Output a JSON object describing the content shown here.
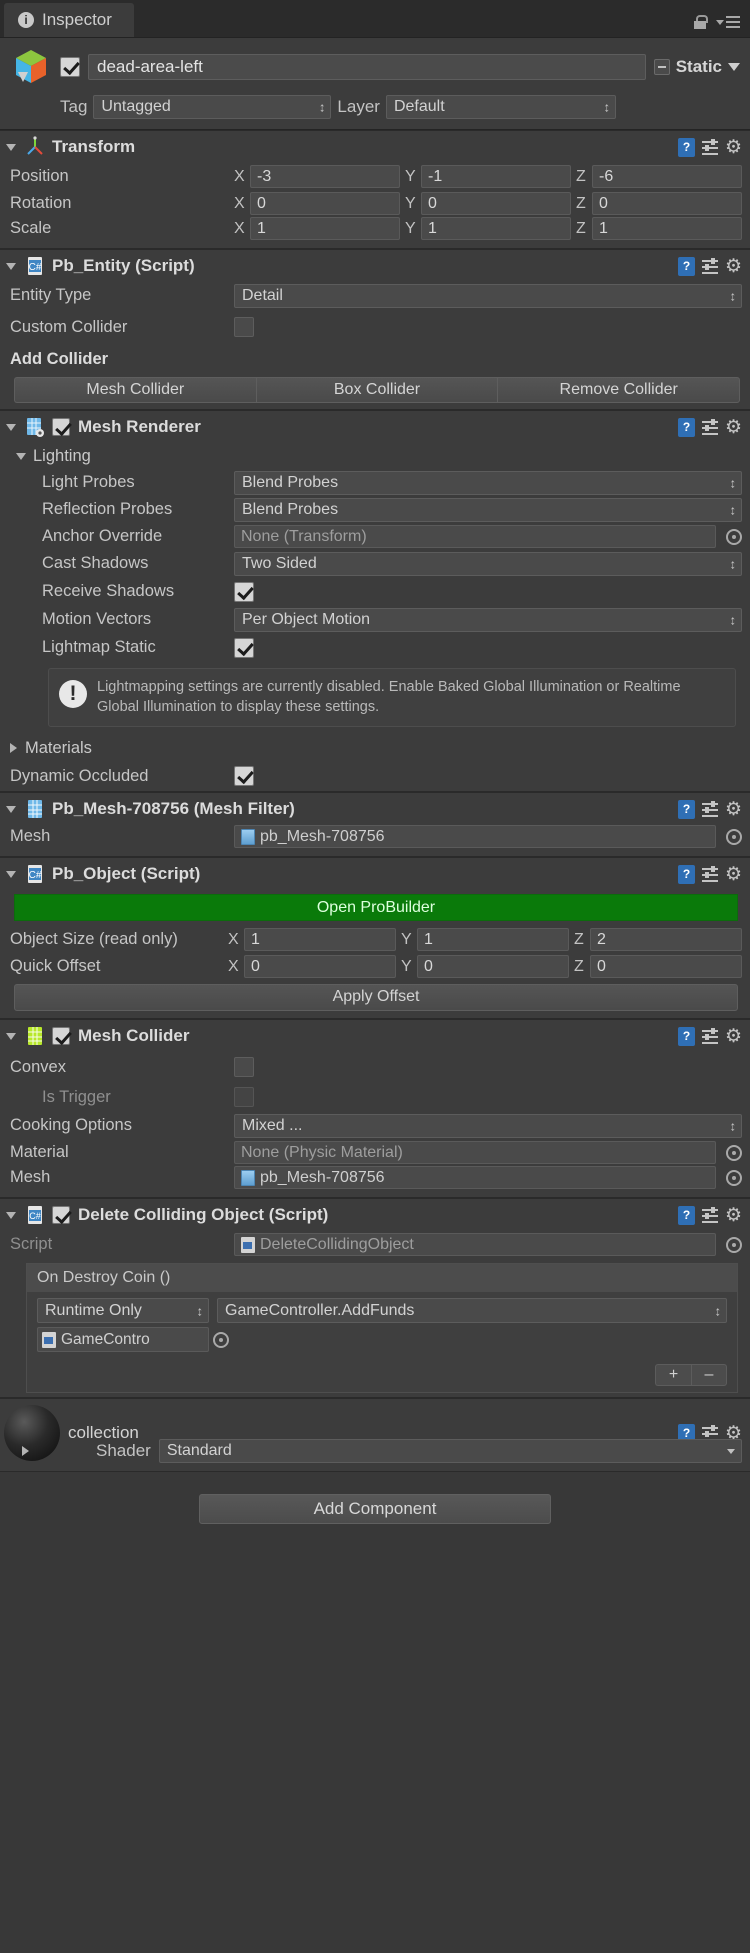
{
  "window": {
    "tab_label": "Inspector",
    "tab_icon": "info-icon",
    "lock_icon": "lock-icon",
    "menu_icon": "overflow-menu-icon"
  },
  "gameobject": {
    "icon": "prefab-cube-icon",
    "enabled": true,
    "name": "dead-area-left",
    "static_label": "Static",
    "tag_label": "Tag",
    "tag_value": "Untagged",
    "layer_label": "Layer",
    "layer_value": "Default"
  },
  "components": [
    {
      "id": "transform",
      "title": "Transform",
      "icon": "transform-axis-icon",
      "rows": [
        {
          "label": "Position",
          "x": "-3",
          "y": "-1",
          "z": "-6"
        },
        {
          "label": "Rotation",
          "x": "0",
          "y": "0",
          "z": "0"
        },
        {
          "label": "Scale",
          "x": "1",
          "y": "1",
          "z": "1"
        }
      ]
    },
    {
      "id": "pb_entity",
      "title": "Pb_Entity (Script)",
      "icon": "cs-script-icon",
      "entity_type_label": "Entity Type",
      "entity_type_value": "Detail",
      "custom_collider_label": "Custom Collider",
      "custom_collider_checked": false,
      "add_collider_label": "Add Collider",
      "buttons": [
        "Mesh Collider",
        "Box Collider",
        "Remove Collider"
      ]
    },
    {
      "id": "mesh_renderer",
      "title": "Mesh Renderer",
      "icon": "mesh-renderer-icon",
      "enabled": true,
      "lighting_label": "Lighting",
      "light_probes_label": "Light Probes",
      "light_probes_value": "Blend Probes",
      "reflection_probes_label": "Reflection Probes",
      "reflection_probes_value": "Blend Probes",
      "anchor_override_label": "Anchor Override",
      "anchor_override_value": "None (Transform)",
      "cast_shadows_label": "Cast Shadows",
      "cast_shadows_value": "Two Sided",
      "receive_shadows_label": "Receive Shadows",
      "receive_shadows_checked": true,
      "motion_vectors_label": "Motion Vectors",
      "motion_vectors_value": "Per Object Motion",
      "lightmap_static_label": "Lightmap Static",
      "lightmap_static_checked": true,
      "help_text": "Lightmapping settings are currently disabled. Enable Baked Global Illumination or Realtime Global Illumination to display these settings.",
      "materials_label": "Materials",
      "dynamic_occluded_label": "Dynamic Occluded",
      "dynamic_occluded_checked": true
    },
    {
      "id": "mesh_filter",
      "title": "Pb_Mesh-708756 (Mesh Filter)",
      "icon": "mesh-filter-icon",
      "mesh_label": "Mesh",
      "mesh_value": "pb_Mesh-708756"
    },
    {
      "id": "pb_object",
      "title": "Pb_Object (Script)",
      "icon": "cs-script-icon",
      "open_probuilder_label": "Open ProBuilder",
      "object_size_label": "Object Size (read only)",
      "object_size": {
        "x": "1",
        "y": "1",
        "z": "2"
      },
      "quick_offset_label": "Quick Offset",
      "quick_offset": {
        "x": "0",
        "y": "0",
        "z": "0"
      },
      "apply_offset_label": "Apply Offset"
    },
    {
      "id": "mesh_collider",
      "title": "Mesh Collider",
      "icon": "mesh-collider-icon",
      "enabled": true,
      "convex_label": "Convex",
      "convex_checked": false,
      "is_trigger_label": "Is Trigger",
      "is_trigger_checked": false,
      "cooking_options_label": "Cooking Options",
      "cooking_options_value": "Mixed ...",
      "material_label": "Material",
      "material_value": "None (Physic Material)",
      "mesh_label": "Mesh",
      "mesh_value": "pb_Mesh-708756"
    },
    {
      "id": "delete_colliding_object",
      "title": "Delete Colliding Object (Script)",
      "icon": "cs-script-icon",
      "enabled": true,
      "script_label": "Script",
      "script_value": "DeleteCollidingObject",
      "event_title": "On Destroy Coin ()",
      "event_mode": "Runtime Only",
      "event_function": "GameController.AddFunds",
      "event_object": "GameContro",
      "add_button": "+",
      "remove_button": "–"
    }
  ],
  "material": {
    "name": "collection",
    "shader_label": "Shader",
    "shader_value": "Standard",
    "preview_icon": "material-sphere-preview"
  },
  "footer": {
    "add_component_label": "Add Component"
  },
  "colors": {
    "panel_bg": "#383838",
    "component_bg": "#3c3c3c",
    "field_bg": "#4a4a4a",
    "accent_green": "#0a7a0a",
    "help_blue": "#2f6fb5"
  }
}
